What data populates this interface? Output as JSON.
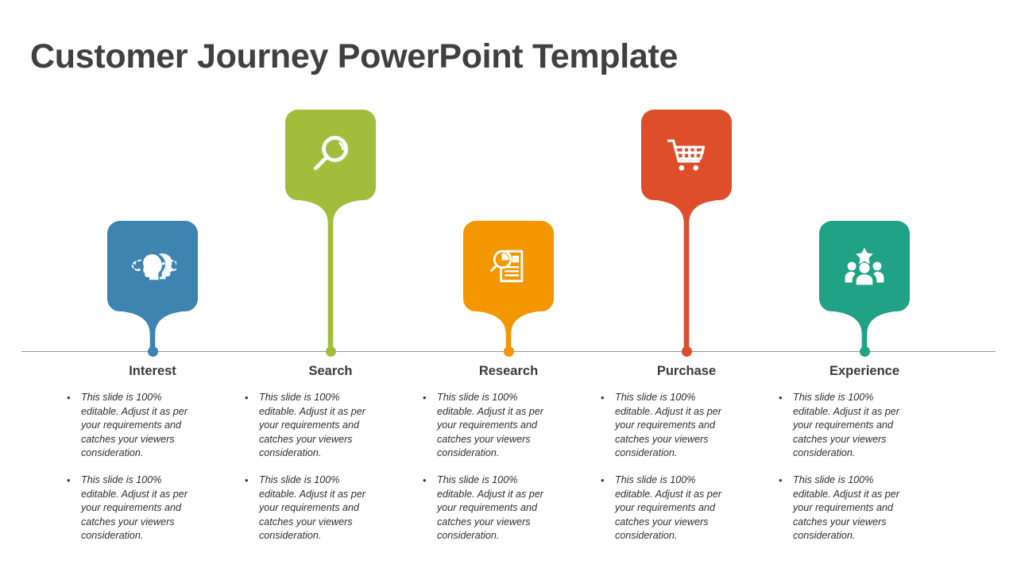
{
  "slide": {
    "title": "Customer Journey PowerPoint Template",
    "background": "#FFFFFF",
    "baseline_color": "#9A9A9A"
  },
  "bullet_text": "This slide is 100% editable. Adjust it as per your requirements and catches your viewers consideration.",
  "stages": [
    {
      "label": "Interest",
      "color": "#3D85B0",
      "icon": "heads-thinking-icon",
      "height": "short",
      "bullets": [
        "This slide is 100% editable. Adjust it as per your requirements and catches your viewers consideration.",
        "This slide is 100% editable. Adjust it as per your requirements and catches your viewers consideration."
      ]
    },
    {
      "label": "Search",
      "color": "#A2BC3C",
      "icon": "magnifier-icon",
      "height": "tall",
      "bullets": [
        "This slide is 100% editable. Adjust it as per your requirements and catches your viewers consideration.",
        "This slide is 100% editable. Adjust it as per your requirements and catches your viewers consideration."
      ]
    },
    {
      "label": "Research",
      "color": "#F49600",
      "icon": "document-analysis-icon",
      "height": "short",
      "bullets": [
        "This slide is 100% editable. Adjust it as per your requirements and catches your viewers consideration.",
        "This slide is 100% editable. Adjust it as per your requirements and catches your viewers consideration."
      ]
    },
    {
      "label": "Purchase",
      "color": "#DF4E2A",
      "icon": "shopping-cart-icon",
      "height": "tall",
      "bullets": [
        "This slide is 100% editable. Adjust it as per your requirements and catches your viewers consideration.",
        "This slide is 100% editable. Adjust it as per your requirements and catches your viewers consideration."
      ]
    },
    {
      "label": "Experience",
      "color": "#20A286",
      "icon": "people-star-icon",
      "height": "short",
      "bullets": [
        "This slide is 100% editable. Adjust it as per your requirements and catches your viewers consideration.",
        "This slide is 100% editable. Adjust it as per your requirements and catches your viewers consideration."
      ]
    }
  ]
}
